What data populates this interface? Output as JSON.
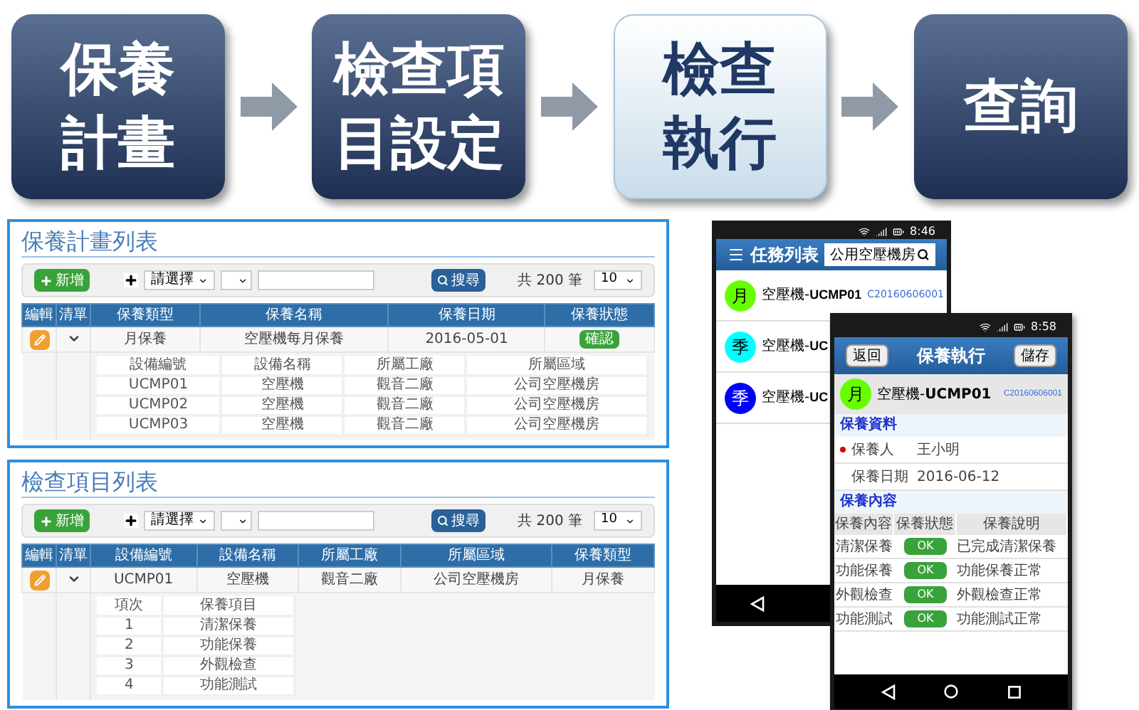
{
  "flow": [
    {
      "lines": [
        "保養",
        "計畫"
      ],
      "selected": false
    },
    {
      "lines": [
        "檢查項",
        "目設定"
      ],
      "selected": false
    },
    {
      "lines": [
        "檢查",
        "執行"
      ],
      "selected": true
    },
    {
      "lines": [
        "查詢"
      ],
      "selected": false
    }
  ],
  "panels": [
    {
      "title": "保養計畫列表",
      "toolbar": {
        "add": "新增",
        "filter": "請選擇",
        "search": "搜尋",
        "count": "共 200 筆",
        "page_size": "10"
      },
      "columns": [
        "編輯",
        "清單",
        "保養類型",
        "保養名稱",
        "保養日期",
        "保養狀態"
      ],
      "rows": [
        {
          "cells": [
            {
              "kind": "edit"
            },
            {
              "kind": "toggle",
              "expanded": true
            },
            {
              "kind": "text",
              "text": "月保養"
            },
            {
              "kind": "text",
              "text": "空壓機每月保養"
            },
            {
              "kind": "text",
              "text": "2016-05-01"
            },
            {
              "kind": "button",
              "text": "確認"
            }
          ]
        }
      ],
      "sub_columns": [
        "設備編號",
        "設備名稱",
        "所屬工廠",
        "所屬區域"
      ],
      "sub_rows": [
        [
          "UCMP01",
          "空壓機",
          "觀音二廠",
          "公司空壓機房"
        ],
        [
          "UCMP02",
          "空壓機",
          "觀音二廠",
          "公司空壓機房"
        ],
        [
          "UCMP03",
          "空壓機",
          "觀音二廠",
          "公司空壓機房"
        ]
      ]
    },
    {
      "title": "檢查項目列表",
      "toolbar": {
        "add": "新增",
        "filter": "請選擇",
        "search": "搜尋",
        "count": "共 200 筆",
        "page_size": "10"
      },
      "columns": [
        "編輯",
        "清單",
        "設備編號",
        "設備名稱",
        "所屬工廠",
        "所屬區域",
        "保養類型"
      ],
      "rows": [
        {
          "cells": [
            {
              "kind": "edit"
            },
            {
              "kind": "toggle",
              "expanded": true
            },
            {
              "kind": "text",
              "text": "UCMP01"
            },
            {
              "kind": "text",
              "text": "空壓機"
            },
            {
              "kind": "text",
              "text": "觀音二廠"
            },
            {
              "kind": "text",
              "text": "公司空壓機房"
            },
            {
              "kind": "text",
              "text": "月保養"
            }
          ]
        }
      ],
      "sub_columns": [
        "項次",
        "保養項目"
      ],
      "sub_rows": [
        [
          "1",
          "清潔保養"
        ],
        [
          "2",
          "功能保養"
        ],
        [
          "3",
          "外觀檢查"
        ],
        [
          "4",
          "功能測試"
        ]
      ]
    }
  ],
  "task_phone": {
    "time": "8:46",
    "title": "任務列表",
    "search_value": "公用空壓機房",
    "tasks": [
      {
        "badge": "月",
        "color": "#66ff00",
        "name": "空壓機-",
        "code": "UCMP01",
        "number": "C20160606001"
      },
      {
        "badge": "季",
        "color": "#00ffff",
        "name": "空壓機-",
        "code": "UC"
      },
      {
        "badge": "季",
        "color": "#0000ff",
        "name": "空壓機-",
        "code": "UC"
      }
    ]
  },
  "exec_phone": {
    "time": "8:58",
    "back": "返回",
    "title": "保養執行",
    "save": "儲存",
    "header": {
      "badge": "月",
      "color": "#66ff00",
      "name": "空壓機-",
      "code": "UCMP01",
      "number": "C20160606001"
    },
    "info_title": "保養資料",
    "fields": [
      {
        "label": "保養人",
        "value": "王小明",
        "required": true
      },
      {
        "label": "保養日期",
        "value": "2016-06-12",
        "required": false
      }
    ],
    "content_title": "保養內容",
    "columns": [
      "保養內容",
      "保養狀態",
      "保養說明"
    ],
    "rows": [
      {
        "item": "清潔保養",
        "status": "OK",
        "note": "已完成清潔保養"
      },
      {
        "item": "功能保養",
        "status": "OK",
        "note": "功能保養正常"
      },
      {
        "item": "外觀檢查",
        "status": "OK",
        "note": "外觀檢查正常"
      },
      {
        "item": "功能測試",
        "status": "OK",
        "note": "功能測試正常"
      }
    ]
  }
}
